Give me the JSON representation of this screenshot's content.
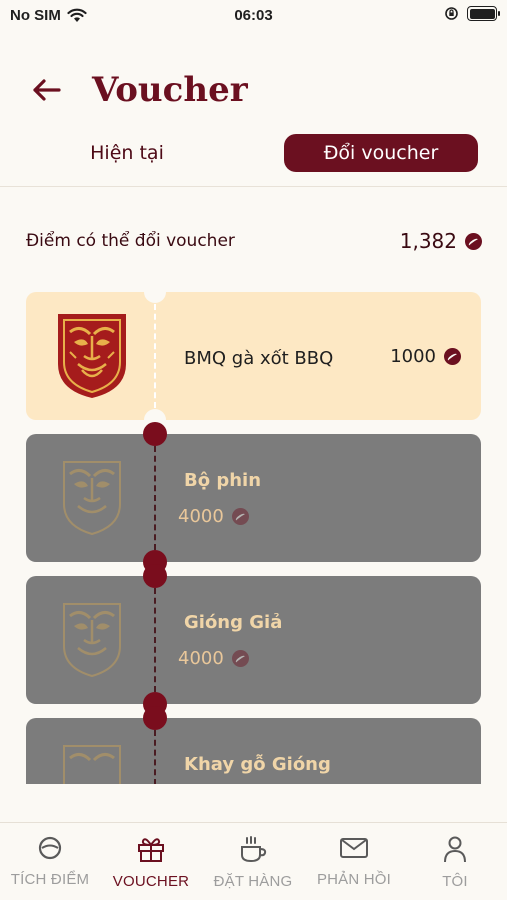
{
  "status_bar": {
    "carrier": "No SIM",
    "time": "06:03"
  },
  "header": {
    "title": "Voucher"
  },
  "tabs": [
    {
      "label": "Hiện tại",
      "active": false
    },
    {
      "label": "Đổi voucher",
      "active": true
    }
  ],
  "points": {
    "label": "Điểm có thể đổi voucher",
    "value": "1,382"
  },
  "vouchers": [
    {
      "name": "BMQ gà xốt BBQ",
      "price": "1000",
      "available": true
    },
    {
      "name": "Bộ phin",
      "price": "4000",
      "available": false
    },
    {
      "name": "Gióng Giả",
      "price": "4000",
      "available": false
    },
    {
      "name": "Khay gỗ Gióng",
      "price": "",
      "available": false
    }
  ],
  "bottom_nav": [
    {
      "label": "TÍCH ĐIỂM",
      "icon": "coffee-bean-icon",
      "active": false
    },
    {
      "label": "VOUCHER",
      "icon": "gift-icon",
      "active": true
    },
    {
      "label": "ĐẶT HÀNG",
      "icon": "coffee-cup-icon",
      "active": false
    },
    {
      "label": "PHẢN HỒI",
      "icon": "mail-icon",
      "active": false
    },
    {
      "label": "TÔI",
      "icon": "user-icon",
      "active": false
    }
  ],
  "colors": {
    "brand": "#6b1020",
    "available_card": "#fde8c4",
    "locked_card": "#7c7c7c",
    "background": "#fbf9f4"
  }
}
